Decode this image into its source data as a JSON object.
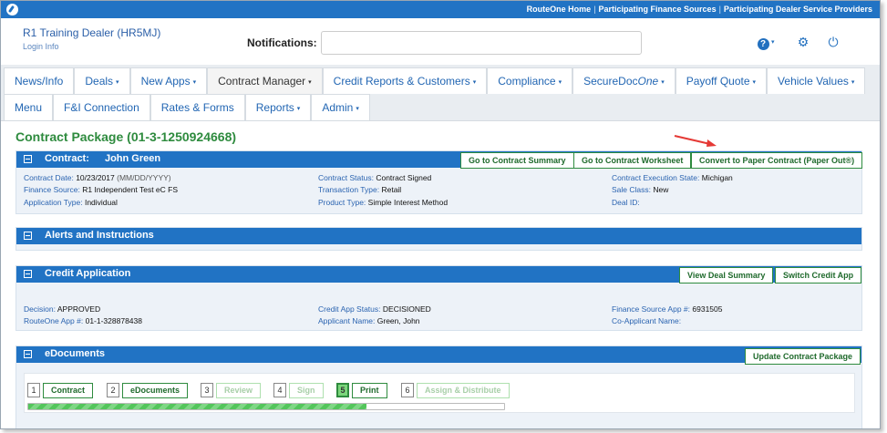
{
  "topbar": {
    "links": [
      "RouteOne Home",
      "Participating Finance Sources",
      "Participating Dealer Service Providers"
    ]
  },
  "header": {
    "dealer_name": "R1 Training Dealer (HR5MJ)",
    "login_info": "Login Info",
    "notifications_label": "Notifications:",
    "notifications_value": "",
    "icons": [
      "help-icon",
      "gear-icon",
      "power-icon"
    ]
  },
  "nav": {
    "row1": [
      {
        "label": "News/Info",
        "dropdown": false
      },
      {
        "label": "Deals",
        "dropdown": true
      },
      {
        "label": "New Apps",
        "dropdown": true
      },
      {
        "label": "Contract Manager",
        "dropdown": true,
        "active": true
      },
      {
        "label": "Credit Reports & Customers",
        "dropdown": true
      },
      {
        "label": "Compliance",
        "dropdown": true
      },
      {
        "label_a": "SecureDoc",
        "label_b": "One",
        "dropdown": true
      },
      {
        "label": "Payoff Quote",
        "dropdown": true
      },
      {
        "label": "Vehicle Values",
        "dropdown": true
      }
    ],
    "row2": [
      {
        "label": "Menu",
        "dropdown": false
      },
      {
        "label": "F&I Connection",
        "dropdown": false
      },
      {
        "label": "Rates & Forms",
        "dropdown": false
      },
      {
        "label": "Reports",
        "dropdown": true
      },
      {
        "label": "Admin",
        "dropdown": true
      }
    ],
    "caret": "▾"
  },
  "page": {
    "title": "Contract Package (01-3-1250924668)"
  },
  "contract_panel": {
    "title_label": "Contract:",
    "customer_name": "John Green",
    "buttons": [
      "Go to Contract Summary",
      "Go to Contract Worksheet",
      "Convert to Paper Contract (Paper Out®)"
    ],
    "fields": {
      "contract_date": {
        "label": "Contract Date:",
        "value": "10/23/2017",
        "hint": "(MM/DD/YYYY)"
      },
      "finance_source": {
        "label": "Finance Source:",
        "value": "R1 Independent Test eC FS"
      },
      "application_type": {
        "label": "Application Type:",
        "value": "Individual"
      },
      "contract_status": {
        "label": "Contract Status:",
        "value": "Contract Signed"
      },
      "transaction_type": {
        "label": "Transaction Type:",
        "value": "Retail"
      },
      "product_type": {
        "label": "Product Type:",
        "value": "Simple Interest Method"
      },
      "execution_state": {
        "label": "Contract Execution State:",
        "value": "Michigan"
      },
      "sale_class": {
        "label": "Sale Class:",
        "value": "New"
      },
      "deal_id": {
        "label": "Deal ID:",
        "value": ""
      }
    }
  },
  "alerts_panel": {
    "title": "Alerts and Instructions"
  },
  "credit_panel": {
    "title": "Credit Application",
    "buttons": [
      "View Deal Summary",
      "Switch Credit App"
    ],
    "fields": {
      "decision": {
        "label": "Decision:",
        "value": "APPROVED"
      },
      "routeone_app": {
        "label": "RouteOne App #:",
        "value": "01-1-328878438"
      },
      "credit_app_status": {
        "label": "Credit App Status:",
        "value": "DECISIONED"
      },
      "applicant_name": {
        "label": "Applicant Name:",
        "value": "Green, John"
      },
      "finance_source_app": {
        "label": "Finance Source App #:",
        "value": "6931505"
      },
      "co_applicant": {
        "label": "Co-Applicant Name:",
        "value": ""
      }
    }
  },
  "edocs_panel": {
    "title": "eDocuments",
    "update_button": "Update Contract Package",
    "steps": [
      {
        "num": "1",
        "label": "Contract",
        "enabled": true
      },
      {
        "num": "2",
        "label": "eDocuments",
        "enabled": true
      },
      {
        "num": "3",
        "label": "Review",
        "enabled": false
      },
      {
        "num": "4",
        "label": "Sign",
        "enabled": false
      },
      {
        "num": "5",
        "label": "Print",
        "enabled": true,
        "current": true
      },
      {
        "num": "6",
        "label": "Assign & Distribute",
        "enabled": false
      }
    ],
    "progress_fraction": 0.71
  },
  "colors": {
    "brand_blue": "#2173c4",
    "title_green": "#2e8b3e",
    "link_blue": "#2266b3",
    "annotation_red": "#e53935"
  }
}
